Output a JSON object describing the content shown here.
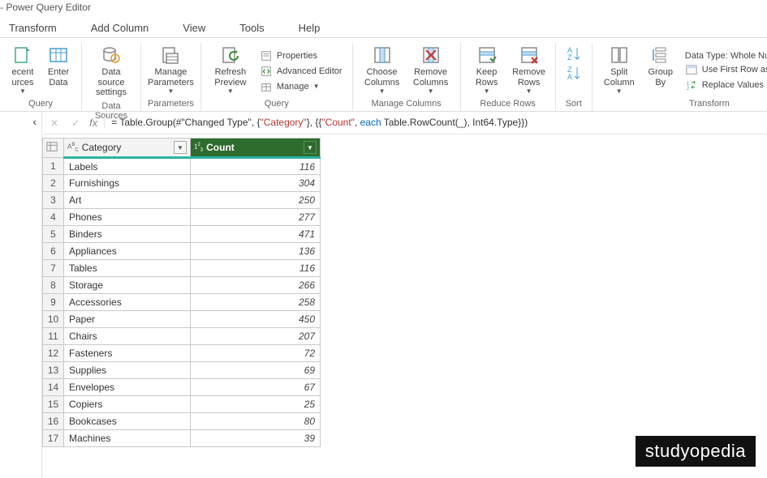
{
  "title": "- Power Query Editor",
  "menu": [
    "Transform",
    "Add Column",
    "View",
    "Tools",
    "Help"
  ],
  "ribbon": {
    "newquery": {
      "label": "Query",
      "recent": "ecent\nurces",
      "enter": "Enter\nData"
    },
    "datasources": {
      "label": "Data Sources",
      "settings": "Data source\nsettings"
    },
    "parameters": {
      "label": "Parameters",
      "manage": "Manage\nParameters"
    },
    "query": {
      "label": "Query",
      "refresh": "Refresh\nPreview",
      "props": "Properties",
      "adv": "Advanced Editor",
      "manage": "Manage"
    },
    "managecols": {
      "label": "Manage Columns",
      "choose": "Choose\nColumns",
      "remove": "Remove\nColumns"
    },
    "reducerows": {
      "label": "Reduce Rows",
      "keep": "Keep\nRows",
      "remove": "Remove\nRows"
    },
    "sort": {
      "label": "Sort"
    },
    "transform": {
      "label": "Transform",
      "split": "Split\nColumn",
      "group": "Group\nBy",
      "datatype": "Data Type: Whole Number",
      "firstrow": "Use First Row as Headers",
      "replace": "Replace Values"
    }
  },
  "formula_parts": {
    "p1": "= Table.Group(#\"Changed Type\", {",
    "p2": "\"Category\"",
    "p3": "}, {{",
    "p4": "\"Count\"",
    "p5": ", ",
    "p6": "each",
    "p7": " Table.RowCount(_), Int64.Type}})"
  },
  "columns": {
    "cat": "Category",
    "cnt": "Count",
    "cat_type": "ABC",
    "cnt_type": "123"
  },
  "rows": [
    {
      "n": 1,
      "cat": "Labels",
      "cnt": 116
    },
    {
      "n": 2,
      "cat": "Furnishings",
      "cnt": 304
    },
    {
      "n": 3,
      "cat": "Art",
      "cnt": 250
    },
    {
      "n": 4,
      "cat": "Phones",
      "cnt": 277
    },
    {
      "n": 5,
      "cat": "Binders",
      "cnt": 471
    },
    {
      "n": 6,
      "cat": "Appliances",
      "cnt": 136
    },
    {
      "n": 7,
      "cat": "Tables",
      "cnt": 116
    },
    {
      "n": 8,
      "cat": "Storage",
      "cnt": 266
    },
    {
      "n": 9,
      "cat": "Accessories",
      "cnt": 258
    },
    {
      "n": 10,
      "cat": "Paper",
      "cnt": 450
    },
    {
      "n": 11,
      "cat": "Chairs",
      "cnt": 207
    },
    {
      "n": 12,
      "cat": "Fasteners",
      "cnt": 72
    },
    {
      "n": 13,
      "cat": "Supplies",
      "cnt": 69
    },
    {
      "n": 14,
      "cat": "Envelopes",
      "cnt": 67
    },
    {
      "n": 15,
      "cat": "Copiers",
      "cnt": 25
    },
    {
      "n": 16,
      "cat": "Bookcases",
      "cnt": 80
    },
    {
      "n": 17,
      "cat": "Machines",
      "cnt": 39
    }
  ],
  "watermark": "studyopedia"
}
